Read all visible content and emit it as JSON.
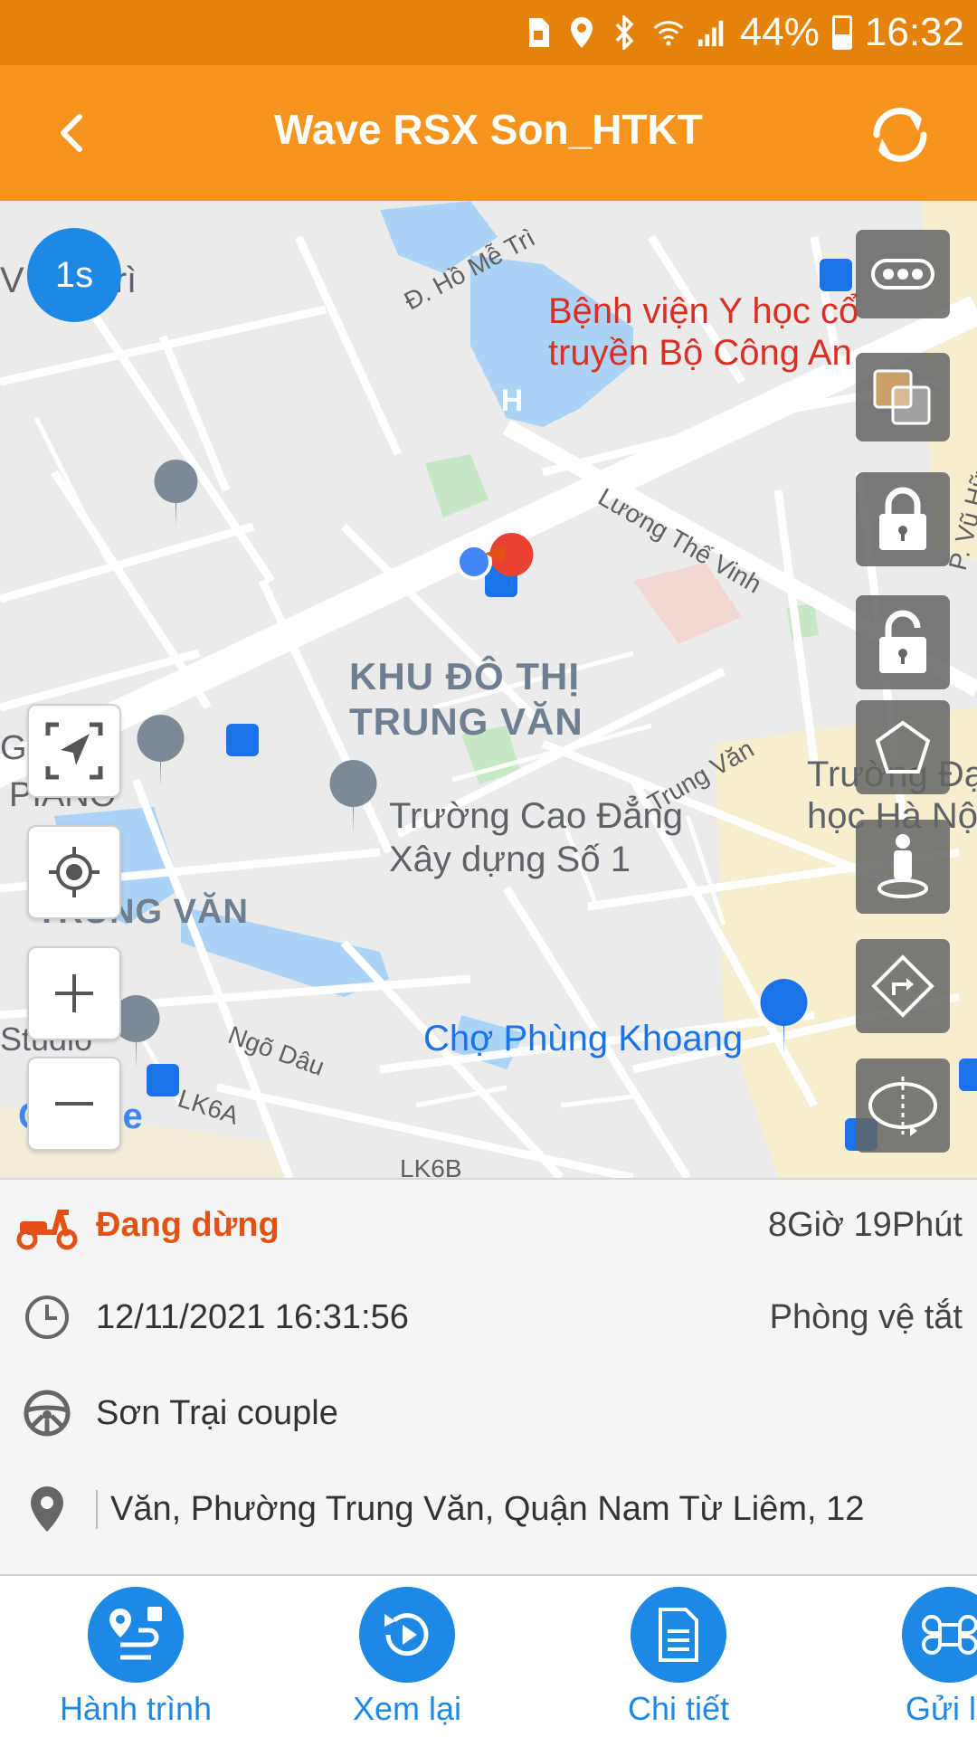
{
  "status_bar": {
    "battery": "44%",
    "time": "16:32",
    "icons": [
      "sim-card-icon",
      "location-icon",
      "bluetooth-icon",
      "wifi-icon",
      "signal-icon",
      "battery-icon"
    ]
  },
  "header": {
    "title": "Wave RSX Son_HTKT",
    "back_icon": "chevron-left-icon",
    "refresh_icon": "refresh-icon"
  },
  "map": {
    "speed_badge": "1s",
    "labels": {
      "poi_me_tri": "V Mễ Trì",
      "street_ho_me_tri": "Đ. Hồ Mễ Trì",
      "hospital_line1": "Bệnh viện Y học cổ",
      "hospital_line2": "truyền Bộ Công An",
      "street_luong_the_vinh": "Lương Thế Vinh",
      "street_vu_huu": "P. Vũ Hữu",
      "area_line1": "KHU ĐÔ THỊ",
      "area_line2": "TRUNG VĂN",
      "piano_g": "G",
      "piano": "PIANO",
      "school_line1": "Trường Cao Đẳng",
      "school_line2": "Xây dựng Số 1",
      "street_trung_van": "Trung Văn",
      "university_line1": "Trường Đạ",
      "university_line2": "học Hà Nộ",
      "trung_van": "TRUNG VĂN",
      "studio": "Studio",
      "street_ngo_dau": "Ngõ Dâu",
      "street_lk6a": "LK6A",
      "street_lk6b": "LK6B",
      "market": "Chợ Phùng Khoang",
      "google": "Google"
    },
    "left_controls": [
      "navigate-arrow-icon",
      "my-location-icon",
      "zoom-in-icon",
      "zoom-out-icon"
    ],
    "right_controls": [
      "more-dots-icon",
      "layers-icon",
      "lock-icon",
      "unlock-icon",
      "pentagon-icon",
      "street-view-icon",
      "directions-icon",
      "rotate-view-icon"
    ]
  },
  "info": {
    "status": "Đang dừng",
    "duration": "8Giờ 19Phút",
    "datetime": "12/11/2021 16:31:56",
    "guard": "Phòng vệ tắt",
    "driver": "Sơn Trại couple",
    "address": "Văn, Phường Trung Văn, Quận Nam Từ Liêm, 12"
  },
  "bottom_nav": [
    {
      "label": "Hành trình",
      "icon": "route-icon"
    },
    {
      "label": "Xem lại",
      "icon": "replay-icon"
    },
    {
      "label": "Chi tiết",
      "icon": "document-icon"
    },
    {
      "label": "Gửi lệ",
      "icon": "command-icon"
    }
  ],
  "colors": {
    "status_bar": "#e5820a",
    "header": "#f7941d",
    "accent_blue": "#1e88e5",
    "status_orange": "#e35214"
  }
}
